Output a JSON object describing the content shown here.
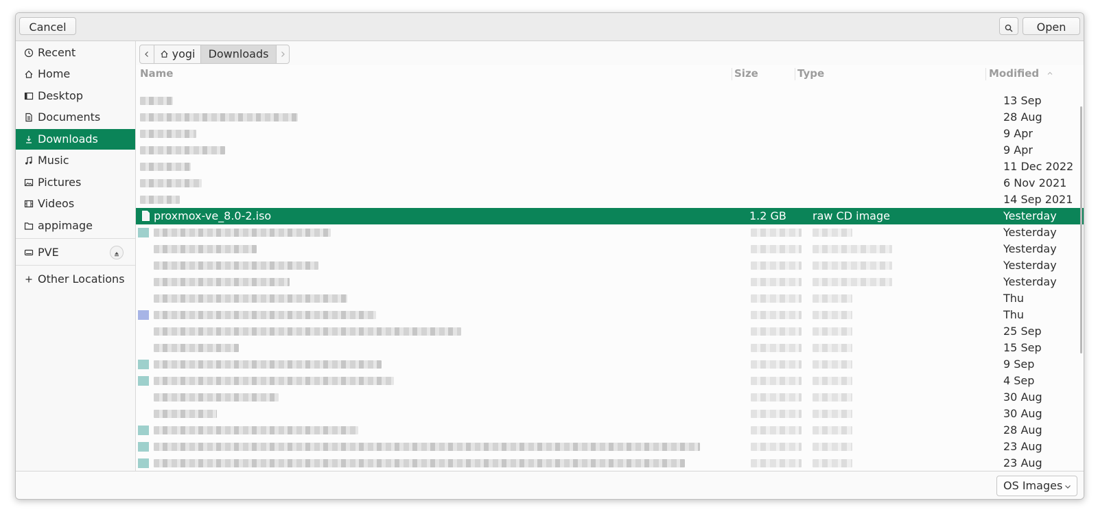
{
  "header": {
    "cancel_label": "Cancel",
    "open_label": "Open"
  },
  "sidebar": {
    "items": [
      {
        "label": "Recent",
        "icon": "clock-icon"
      },
      {
        "label": "Home",
        "icon": "home-icon"
      },
      {
        "label": "Desktop",
        "icon": "desktop-icon"
      },
      {
        "label": "Documents",
        "icon": "document-icon"
      },
      {
        "label": "Downloads",
        "icon": "download-icon",
        "active": true
      },
      {
        "label": "Music",
        "icon": "music-icon"
      },
      {
        "label": "Pictures",
        "icon": "picture-icon"
      },
      {
        "label": "Videos",
        "icon": "video-icon"
      },
      {
        "label": "appimage",
        "icon": "folder-icon"
      }
    ],
    "drive": {
      "label": "PVE",
      "icon": "drive-icon"
    },
    "other": {
      "label": "Other Locations",
      "icon": "plus-icon"
    }
  },
  "pathbar": {
    "home_label": "yogi",
    "current_label": "Downloads"
  },
  "columns": {
    "name": "Name",
    "size": "Size",
    "type": "Type",
    "modified": "Modified"
  },
  "files": [
    {
      "modified": "13 Sep"
    },
    {
      "modified": "28 Aug"
    },
    {
      "modified": "9 Apr"
    },
    {
      "modified": "9 Apr"
    },
    {
      "modified": "11 Dec 2022"
    },
    {
      "modified": "6 Nov 2021"
    },
    {
      "modified": "14 Sep 2021"
    },
    {
      "name": "proxmox-ve_8.0-2.iso",
      "size": "1.2 GB",
      "type": "raw CD image",
      "modified": "Yesterday",
      "selected": true
    },
    {
      "modified": "Yesterday"
    },
    {
      "modified": "Yesterday"
    },
    {
      "modified": "Yesterday"
    },
    {
      "modified": "Yesterday"
    },
    {
      "modified": "Thu"
    },
    {
      "modified": "Thu"
    },
    {
      "modified": "25 Sep"
    },
    {
      "modified": "15 Sep"
    },
    {
      "modified": "9 Sep"
    },
    {
      "modified": "4 Sep"
    },
    {
      "modified": "30 Aug"
    },
    {
      "modified": "30 Aug"
    },
    {
      "modified": "28 Aug"
    },
    {
      "modified": "23 Aug"
    },
    {
      "modified": "23 Aug"
    }
  ],
  "footer": {
    "filter_label": "OS Images"
  },
  "colors": {
    "accent": "#0b8458"
  }
}
